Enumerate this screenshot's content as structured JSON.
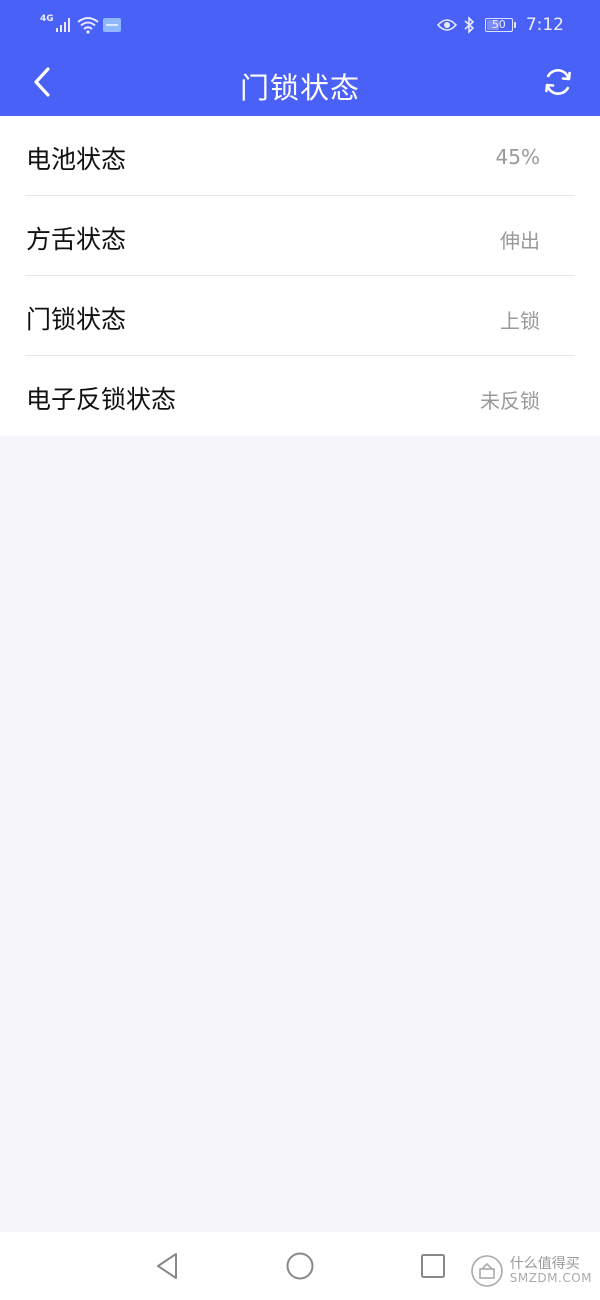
{
  "status_bar": {
    "network": "4G",
    "battery_level": "50",
    "time": "7:12"
  },
  "toolbar": {
    "title": "门锁状态",
    "back_icon": "chevron-left-icon",
    "refresh_icon": "refresh-icon"
  },
  "status_items": [
    {
      "label": "电池状态",
      "value": "45%"
    },
    {
      "label": "方舌状态",
      "value": "伸出"
    },
    {
      "label": "门锁状态",
      "value": "上锁"
    },
    {
      "label": "电子反锁状态",
      "value": "未反锁"
    }
  ],
  "nav_bar": {
    "back_icon": "triangle-back-icon",
    "home_icon": "circle-home-icon",
    "recents_icon": "square-recents-icon"
  },
  "watermark": {
    "cn": "什么值得买",
    "en": "SMZDM.COM"
  },
  "colors": {
    "header": "#4a61f7",
    "background": "#f5f5fa",
    "value_text": "#999999"
  }
}
